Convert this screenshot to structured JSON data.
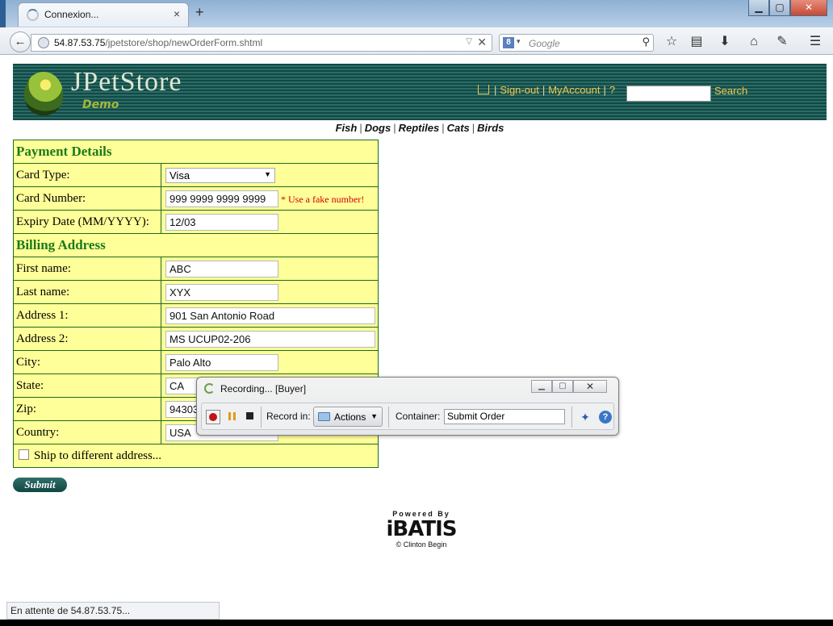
{
  "browser": {
    "tab_title": "Connexion...",
    "tab_close": "×",
    "new_tab": "+",
    "url_host": "54.87.53.75",
    "url_path": "/jpetstore/shop/newOrderForm.shtml",
    "search_engine_glyph": "8",
    "search_placeholder": "Google",
    "window_controls": {
      "minimize": "▁",
      "maximize": "▢",
      "close": "✕"
    }
  },
  "toolbar_icons": [
    "star-icon",
    "bookmarks-list-icon",
    "download-icon",
    "home-icon",
    "addon-icon",
    "menu-icon"
  ],
  "store_header": {
    "logo_title": "JPetStore",
    "logo_subtitle": "Demo",
    "sign_out": "Sign-out",
    "my_account": "MyAccount",
    "help": "?",
    "search_button": "Search"
  },
  "quick_links": [
    "Fish",
    "Dogs",
    "Reptiles",
    "Cats",
    "Birds"
  ],
  "payment": {
    "section_title": "Payment Details",
    "card_type_label": "Card Type:",
    "card_type_value": "Visa",
    "card_number_label": "Card Number:",
    "card_number_value": "999 9999 9999 9999",
    "card_number_note": "* Use a fake number!",
    "expiry_label": "Expiry Date (MM/YYYY):",
    "expiry_value": "12/03"
  },
  "billing": {
    "section_title": "Billing Address",
    "first_name_label": "First name:",
    "first_name_value": "ABC",
    "last_name_label": "Last name:",
    "last_name_value": "XYX",
    "address1_label": "Address 1:",
    "address1_value": "901 San Antonio Road",
    "address2_label": "Address 2:",
    "address2_value": "MS UCUP02-206",
    "city_label": "City:",
    "city_value": "Palo Alto",
    "state_label": "State:",
    "state_value": "CA",
    "zip_label": "Zip:",
    "zip_value": "94303",
    "country_label": "Country:",
    "country_value": "USA",
    "ship_different_label": "Ship to different address..."
  },
  "submit_label": "Submit",
  "powered": {
    "by": "Powered By",
    "brand": "iBATIS",
    "credit": "© Clinton Begin"
  },
  "status_text": "En attente de 54.87.53.75...",
  "recorder": {
    "title": "Recording... [Buyer]",
    "record_in_label": "Record in:",
    "record_in_value": "Actions",
    "container_label": "Container:",
    "container_value": "Submit Order",
    "help": "?"
  }
}
